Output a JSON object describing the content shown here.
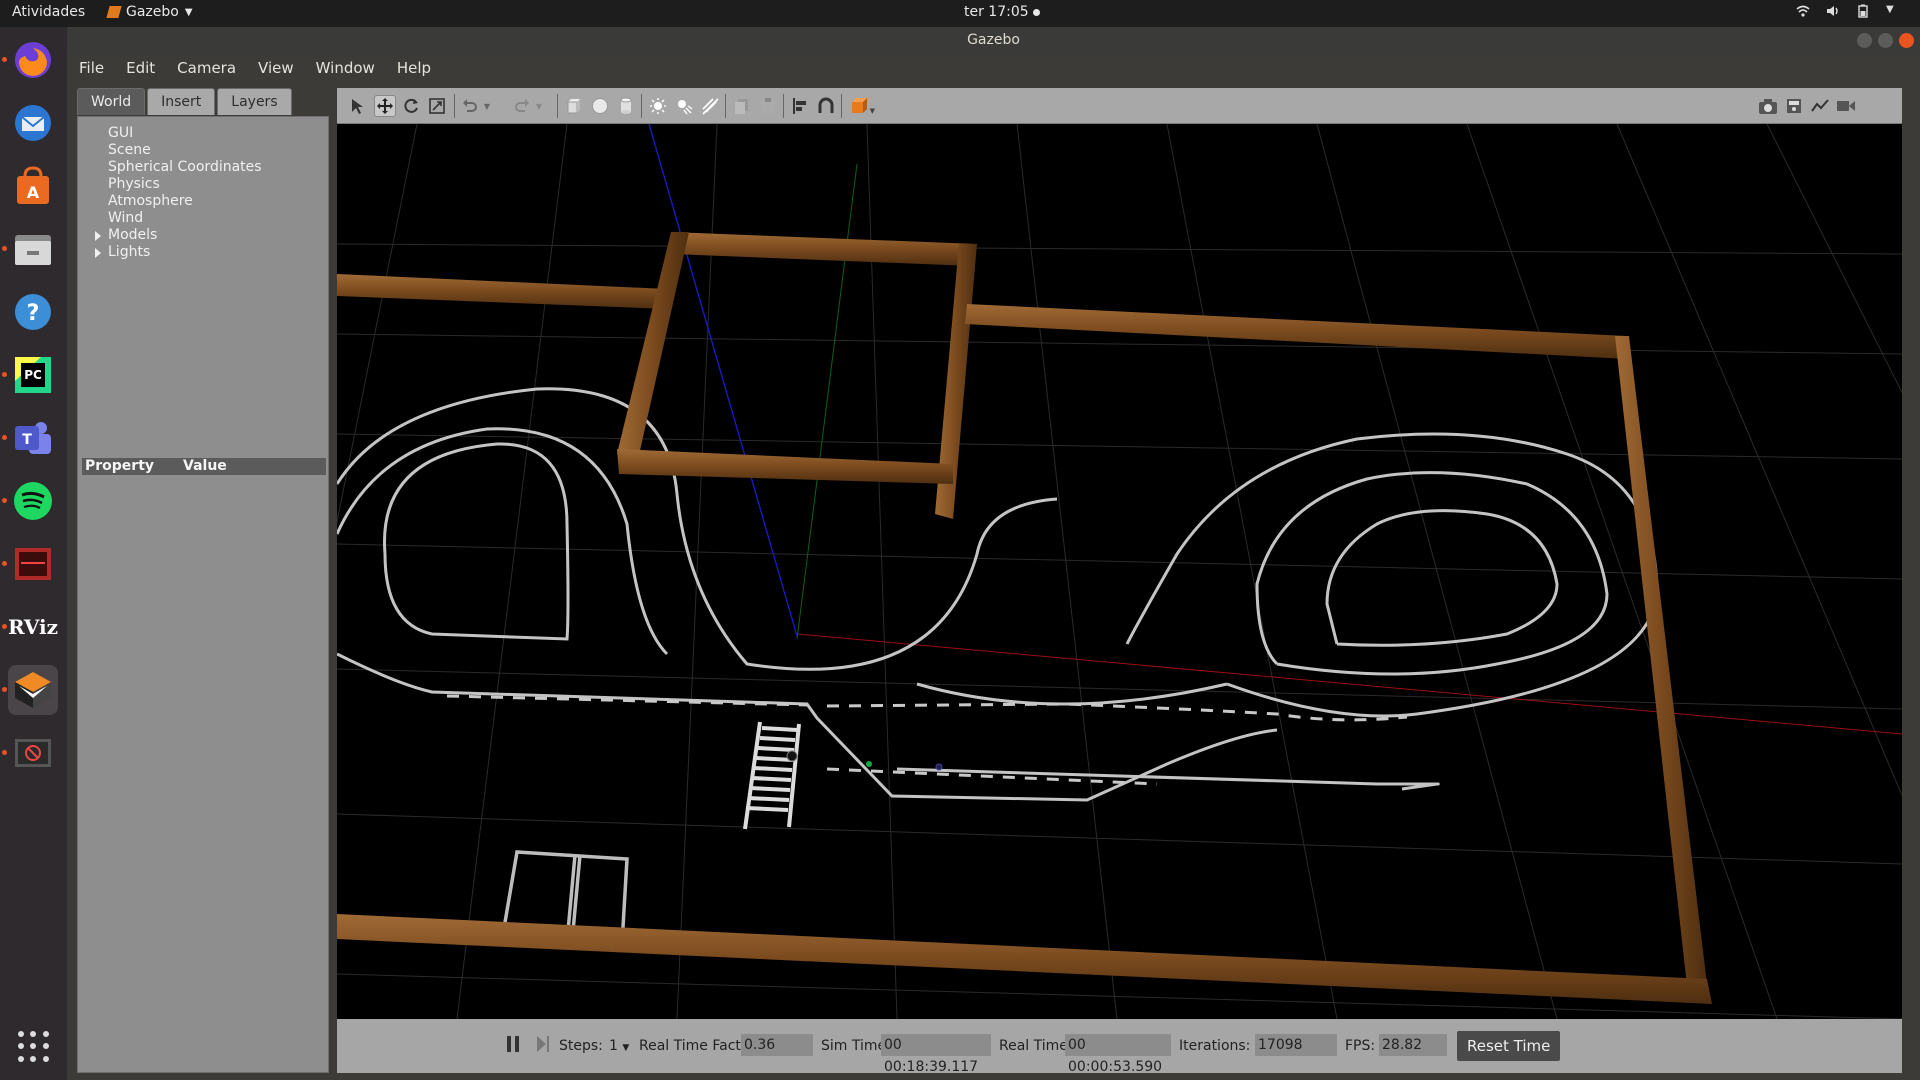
{
  "topbar": {
    "activities": "Atividades",
    "app_name": "Gazebo",
    "clock": "ter 17:05"
  },
  "window": {
    "title": "Gazebo"
  },
  "menu": {
    "file": "File",
    "edit": "Edit",
    "camera": "Camera",
    "view": "View",
    "window": "Window",
    "help": "Help"
  },
  "leftpanel": {
    "tabs": [
      "World",
      "Insert",
      "Layers"
    ],
    "tree": [
      "GUI",
      "Scene",
      "Spherical Coordinates",
      "Physics",
      "Atmosphere",
      "Wind",
      "Models",
      "Lights"
    ],
    "property_header": {
      "property": "Property",
      "value": "Value"
    }
  },
  "dock": {
    "apps": [
      "firefox-icon",
      "thunderbird-icon",
      "software-center-icon",
      "files-icon",
      "help-icon",
      "pycharm-icon",
      "teams-icon",
      "spotify-icon",
      "terminal-app-icon",
      "rviz-icon",
      "gazebo-icon",
      "blocker-app-icon"
    ],
    "rviz_label": "RViz"
  },
  "bottombar": {
    "steps_label": "Steps:",
    "steps_value": "1",
    "rtf_label": "Real Time Factor:",
    "rtf_value": "0.36",
    "sim_time_label": "Sim Time:",
    "sim_time_value": "00 00:18:39.117",
    "real_time_label": "Real Time:",
    "real_time_value": "00 00:00:53.590",
    "iterations_label": "Iterations:",
    "iterations_value": "17098",
    "fps_label": "FPS:",
    "fps_value": "28.82",
    "reset_label": "Reset Time"
  },
  "colors": {
    "wall": "#7a4a1e",
    "track": "#c8c8c8",
    "grid": "#2c2c2c",
    "accent": "#e95420"
  }
}
